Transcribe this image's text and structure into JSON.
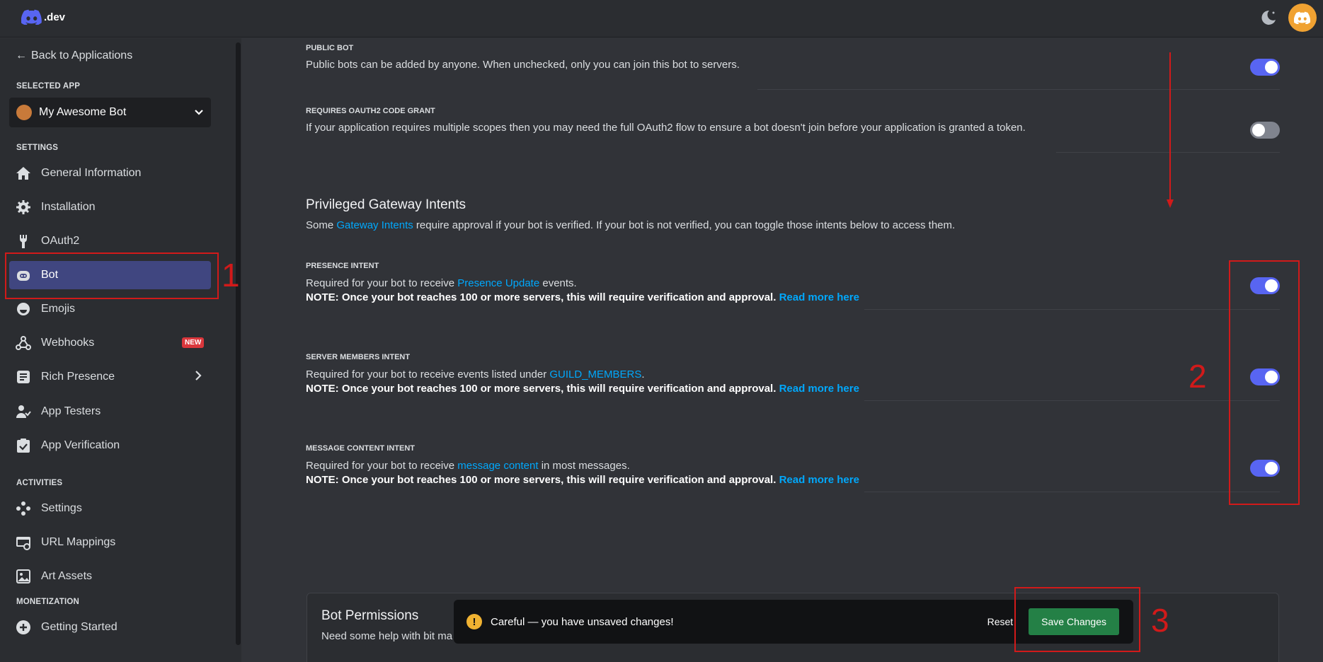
{
  "topbar": {
    "logo_text": ".dev"
  },
  "sidebar": {
    "back_label": "Back to Applications",
    "selected_app_label": "SELECTED APP",
    "app_name": "My Awesome Bot",
    "settings_label": "SETTINGS",
    "settings_items": [
      {
        "label": "General Information",
        "icon": "home-icon"
      },
      {
        "label": "Installation",
        "icon": "gear-icon"
      },
      {
        "label": "OAuth2",
        "icon": "wrench-icon"
      },
      {
        "label": "Bot",
        "icon": "bot-icon",
        "active": true
      },
      {
        "label": "Emojis",
        "icon": "emoji-icon"
      },
      {
        "label": "Webhooks",
        "icon": "webhook-icon",
        "badge": "NEW"
      },
      {
        "label": "Rich Presence",
        "icon": "rich-presence-icon",
        "has_submenu": true
      },
      {
        "label": "App Testers",
        "icon": "app-testers-icon"
      },
      {
        "label": "App Verification",
        "icon": "clipboard-check-icon"
      }
    ],
    "activities_label": "ACTIVITIES",
    "activities_items": [
      {
        "label": "Settings",
        "icon": "gamepad-icon"
      },
      {
        "label": "URL Mappings",
        "icon": "url-mapping-icon"
      },
      {
        "label": "Art Assets",
        "icon": "image-icon"
      }
    ],
    "monetization_label": "MONETIZATION",
    "monetization_items": [
      {
        "label": "Getting Started",
        "icon": "plus-circle-icon"
      }
    ]
  },
  "main": {
    "public_bot": {
      "label": "PUBLIC BOT",
      "desc": "Public bots can be added by anyone. When unchecked, only you can join this bot to servers.",
      "enabled": true
    },
    "oauth2_grant": {
      "label": "REQUIRES OAUTH2 CODE GRANT",
      "desc": "If your application requires multiple scopes then you may need the full OAuth2 flow to ensure a bot doesn't join before your application is granted a token.",
      "enabled": false
    },
    "intents": {
      "title": "Privileged Gateway Intents",
      "desc_pre": "Some ",
      "desc_link": "Gateway Intents",
      "desc_post": " require approval if your bot is verified. If your bot is not verified, you can toggle those intents below to access them."
    },
    "presence": {
      "label": "PRESENCE INTENT",
      "desc_pre": "Required for your bot to receive ",
      "desc_link": "Presence Update",
      "desc_post": " events.",
      "note": "NOTE: Once your bot reaches 100 or more servers, this will require verification and approval.",
      "read_more": "Read more here",
      "enabled": true
    },
    "server_members": {
      "label": "SERVER MEMBERS INTENT",
      "desc_pre": "Required for your bot to receive events listed under ",
      "desc_link": "GUILD_MEMBERS",
      "desc_post": ".",
      "note": "NOTE: Once your bot reaches 100 or more servers, this will require verification and approval.",
      "read_more": "Read more here",
      "enabled": true
    },
    "message_content": {
      "label": "MESSAGE CONTENT INTENT",
      "desc_pre": "Required for your bot to receive ",
      "desc_link": "message content",
      "desc_post": " in most messages.",
      "note": "NOTE: Once your bot reaches 100 or more servers, this will require verification and approval.",
      "read_more": "Read more here",
      "enabled": true
    },
    "permissions": {
      "title": "Bot Permissions",
      "desc": "Need some help with bit ma"
    }
  },
  "unsaved_bar": {
    "message": "Careful — you have unsaved changes!",
    "reset_label": "Reset",
    "save_label": "Save Changes"
  },
  "annotations": {
    "step1": "1",
    "step2": "2",
    "step3": "3"
  },
  "colors": {
    "accent": "#5865f2",
    "link": "#00a8fc",
    "save_green": "#248046",
    "annotation_red": "#d11a1a"
  }
}
